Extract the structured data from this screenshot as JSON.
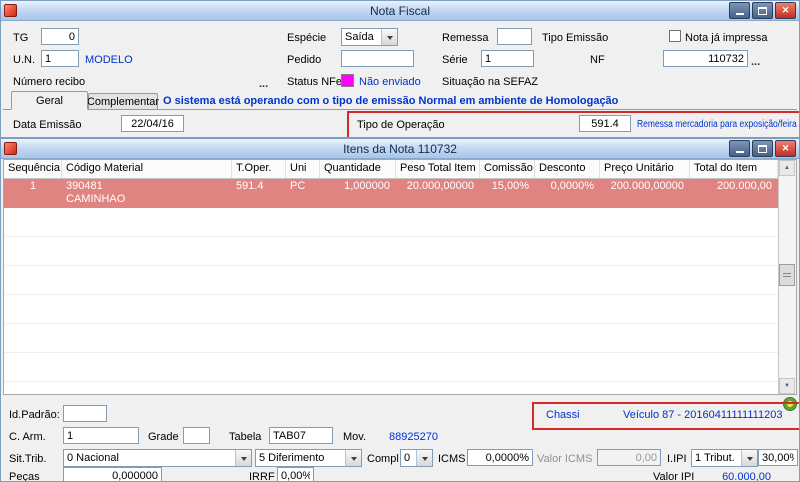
{
  "colors": {
    "accent-blue": "#0033cc",
    "status-magenta": "#ff00ff",
    "row-selected": "#e08482",
    "highlight-red": "#d42a2a"
  },
  "win1": {
    "title": "Nota Fiscal",
    "tg_label": "TG",
    "tg_value": "0",
    "especie_label": "Espécie",
    "especie_value": "Saída",
    "remessa_label": "Remessa",
    "tipo_emissao_label": "Tipo Emissão",
    "nota_impressa_label": "Nota já impressa",
    "un_label": "U.N.",
    "un_value": "1",
    "un_desc": "MODELO",
    "pedido_label": "Pedido",
    "serie_label": "Série",
    "serie_value": "1",
    "nf_label": "NF",
    "nf_value": "110732",
    "browse_dots": "...",
    "numero_recibo_label": "Número recibo",
    "status_nfe_label": "Status NFe",
    "status_nfe_value": "Não enviado",
    "situacao_sefaz_label": "Situação na SEFAZ",
    "tab_geral": "Geral",
    "tab_complementar": "Complementar",
    "banner": "O sistema está operando com o tipo de emissão Normal em ambiente de Homologação",
    "data_emissao_label": "Data Emissão",
    "data_emissao_value": "22/04/16",
    "tipo_operacao_label": "Tipo de Operação",
    "tipo_operacao_value": "591.4",
    "tipo_operacao_desc": "Remessa mercadoria para exposição/feira"
  },
  "win2": {
    "title": "Itens da Nota 110732",
    "table": {
      "headers": [
        "Sequência",
        "Código Material",
        "T.Oper.",
        "Uni",
        "Quantidade",
        "Peso Total Item",
        "Comissão",
        "Desconto",
        "Preço Unitário",
        "Total do Item"
      ],
      "selected_row": {
        "sequencia": "1",
        "codigo_material": "390481",
        "codigo_material_desc": "CAMINHAO",
        "t_oper": "591.4",
        "uni": "PC",
        "quantidade": "1,000000",
        "peso_total_item": "20.000,00000",
        "comissao": "15,00%",
        "desconto": "0,0000%",
        "preco_unitario": "200.000,00000",
        "total_do_item": "200.000,00"
      }
    },
    "footer": {
      "id_padrao_label": "Id.Padrão:",
      "chassi_label": "Chassi",
      "chassi_value": "Veículo 87 - 20160411111111203",
      "c_arm_label": "C. Arm.",
      "c_arm_value": "1",
      "grade_label": "Grade",
      "tabela_label": "Tabela",
      "tabela_value": "TAB07",
      "mov_label": "Mov.",
      "mov_value": "88925270",
      "sit_trib_label": "Sit.Trib.",
      "sit_trib_value": "0 Nacional",
      "diferimento_value": "5 Diferimento",
      "compl_label": "Compl",
      "compl_value": "0",
      "icms_label": "ICMS",
      "icms_value": "0,0000%",
      "valor_icms_label": "Valor ICMS",
      "valor_icms_value": "0,00",
      "ipi_label": "I.IPI",
      "ipi_value": "1 Tribut.",
      "ipi_pct_value": "30,00%",
      "pecas_label": "Peças",
      "pecas_value": "0,000000",
      "irrf_label": "IRRF",
      "irrf_value": "0,00%",
      "valor_ipi_label": "Valor IPI",
      "valor_ipi_value": "60.000,00"
    }
  }
}
